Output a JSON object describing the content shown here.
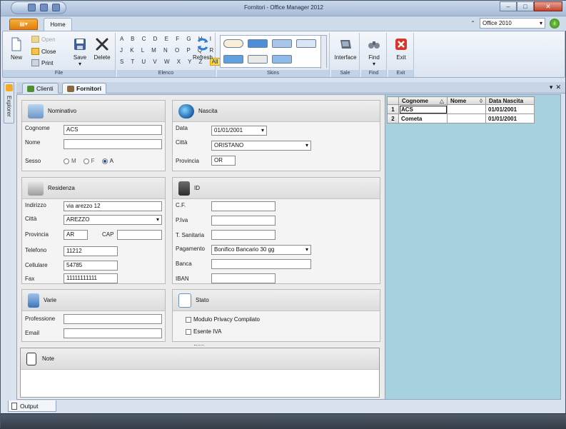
{
  "window": {
    "title": "Fornitori - Office Manager 2012",
    "minimize": "–",
    "maximize": "□",
    "close": "✕"
  },
  "ribbon": {
    "tabs": {
      "file": "▤▾",
      "home": "Home"
    },
    "theme": {
      "chevron": "⌃",
      "selected": "Office 2010"
    },
    "buttons": {
      "new": "New",
      "open": "Open",
      "close": "Close",
      "print": "Print",
      "save": "Save",
      "save_dropdown": "▾",
      "delete": "Delete",
      "refresh": "Refresh",
      "interface": "Interface",
      "find": "Find",
      "find_dropdown": "▾",
      "exit": "Exit"
    },
    "letters_row1": "A B C D E F G H I",
    "letters_row2": "J K L M N O P Q R",
    "letters_row3": "S T U V W X Y Z",
    "letters_all": "All",
    "groups": {
      "file": "File",
      "elenco": "Elenco",
      "skins": "Skins",
      "sale": "Sale",
      "find": "Find",
      "exit": "Exit"
    }
  },
  "explorer_label": "Explorer",
  "doc_tabs": [
    {
      "label": "Clienti"
    },
    {
      "label": "Fornitori"
    }
  ],
  "mdi": {
    "menu": "▾",
    "close": "✕"
  },
  "form": {
    "nominativo": {
      "title": "Nominativo",
      "cognome_label": "Cognome",
      "cognome": "ACS",
      "nome_label": "Nome",
      "nome": "",
      "sesso_label": "Sesso",
      "sesso_options": [
        "M",
        "F",
        "A"
      ],
      "sesso_selected": "A"
    },
    "nascita": {
      "title": "Nascita",
      "data_label": "Data",
      "data": "01/01/2001",
      "citta_label": "Città",
      "citta": "ORISTANO",
      "provincia_label": "Provincia",
      "provincia": "OR"
    },
    "residenza": {
      "title": "Residenza",
      "indirizzo_label": "Indirizzo",
      "indirizzo": "via arezzo 12",
      "citta_label": "Città",
      "citta": "AREZZO",
      "provincia_label": "Provincia",
      "provincia": "AR",
      "cap_label": "CAP",
      "cap": "",
      "telefono_label": "Telefono",
      "telefono": "11212",
      "cellulare_label": "Cellulare",
      "cellulare": "54785",
      "fax_label": "Fax",
      "fax": "11111111111"
    },
    "id": {
      "title": "ID",
      "cf_label": "C.F.",
      "cf": "",
      "piva_label": "P.Iva",
      "piva": "",
      "tsanitaria_label": "T. Sanitaria",
      "tsanitaria": "",
      "pagamento_label": "Pagamento",
      "pagamento": "Bonifico Bancario 30 gg",
      "banca_label": "Banca",
      "banca": "",
      "iban_label": "IBAN",
      "iban": ""
    },
    "varie": {
      "title": "Varie",
      "professione_label": "Professione",
      "professione": "",
      "email_label": "Email",
      "email": ""
    },
    "stato": {
      "title": "Stato",
      "privacy_label": "Modulo Privacy Compilato",
      "privacy_checked": false,
      "esente_label": "Esente IVA",
      "esente_checked": false
    },
    "note": {
      "title": "Note"
    }
  },
  "grid": {
    "headers": {
      "cognome": "Cognome",
      "sort": "△",
      "nome": "Nome",
      "filter": "◊",
      "data": "Data Nascita"
    },
    "rows": [
      {
        "n": "1",
        "cognome": "ACS",
        "nome": "",
        "data": "01/01/2001"
      },
      {
        "n": "2",
        "cognome": "Cometa",
        "nome": "",
        "data": "01/01/2001"
      }
    ]
  },
  "output_tab": "Output",
  "colors": {
    "accent_file_tab": "#e07d12",
    "grid_background": "#a7d1df",
    "status_bar": "#3a4452"
  }
}
